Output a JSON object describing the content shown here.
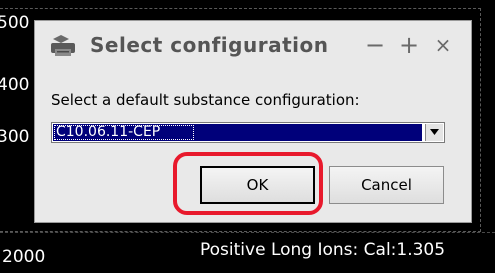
{
  "background": {
    "y_ticks": [
      "500",
      "400",
      "300"
    ],
    "x_tick": "2000",
    "status_text": "Positive Long Ions: Cal:1.305"
  },
  "dialog": {
    "title": "Select configuration",
    "title_icon": "printer-icon",
    "window_controls": {
      "minimize": "−",
      "maximize": "+",
      "close": "×"
    },
    "prompt": "Select a default substance configuration:",
    "selected_value": "C10.06.11-CEP",
    "buttons": {
      "ok": "OK",
      "cancel": "Cancel"
    }
  },
  "colors": {
    "selection_bg": "#00007a",
    "highlight": "#e8192c",
    "dialog_bg": "#e9e9e9"
  }
}
